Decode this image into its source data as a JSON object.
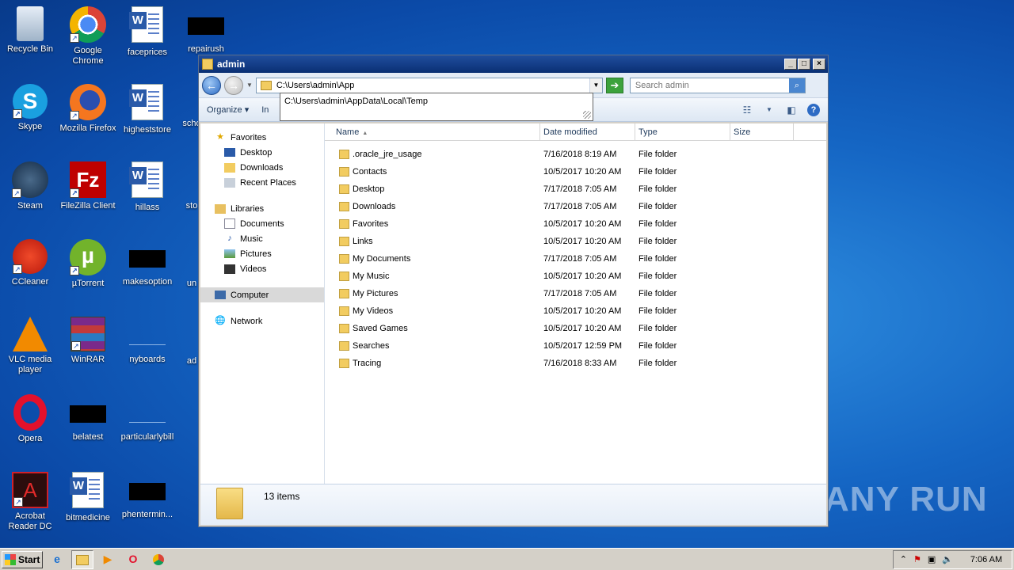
{
  "desktop": {
    "icons": [
      {
        "label": "Recycle Bin"
      },
      {
        "label": "Google Chrome"
      },
      {
        "label": "faceprices"
      },
      {
        "label": "repairush"
      },
      {
        "label": "Skype"
      },
      {
        "label": "Mozilla Firefox"
      },
      {
        "label": "higheststore"
      },
      {
        "label": "scho"
      },
      {
        "label": "Steam"
      },
      {
        "label": "FileZilla Client"
      },
      {
        "label": "hillass"
      },
      {
        "label": "sto"
      },
      {
        "label": "CCleaner"
      },
      {
        "label": "µTorrent"
      },
      {
        "label": "makesoption"
      },
      {
        "label": "un"
      },
      {
        "label": "VLC media player"
      },
      {
        "label": "WinRAR"
      },
      {
        "label": "nyboards"
      },
      {
        "label": "ad"
      },
      {
        "label": "Opera"
      },
      {
        "label": "belatest"
      },
      {
        "label": "particularlybill"
      },
      {
        "label": "Acrobat Reader DC"
      },
      {
        "label": "bitmedicine"
      },
      {
        "label": "phentermin..."
      }
    ]
  },
  "window": {
    "title": "admin",
    "address_value": "C:\\Users\\admin\\App",
    "search_placeholder": "Search admin",
    "suggestion": "C:\\Users\\admin\\AppData\\Local\\Temp",
    "toolbar": {
      "organize": "Organize",
      "include": "In"
    },
    "nav": {
      "favorites": "Favorites",
      "desktop": "Desktop",
      "downloads": "Downloads",
      "recent_places": "Recent Places",
      "libraries": "Libraries",
      "documents": "Documents",
      "music": "Music",
      "pictures": "Pictures",
      "videos": "Videos",
      "computer": "Computer",
      "network": "Network"
    },
    "columns": {
      "name": "Name",
      "date": "Date modified",
      "type": "Type",
      "size": "Size"
    },
    "files": [
      {
        "name": ".oracle_jre_usage",
        "date": "7/16/2018 8:19 AM",
        "type": "File folder"
      },
      {
        "name": "Contacts",
        "date": "10/5/2017 10:20 AM",
        "type": "File folder"
      },
      {
        "name": "Desktop",
        "date": "7/17/2018 7:05 AM",
        "type": "File folder"
      },
      {
        "name": "Downloads",
        "date": "7/17/2018 7:05 AM",
        "type": "File folder"
      },
      {
        "name": "Favorites",
        "date": "10/5/2017 10:20 AM",
        "type": "File folder"
      },
      {
        "name": "Links",
        "date": "10/5/2017 10:20 AM",
        "type": "File folder"
      },
      {
        "name": "My Documents",
        "date": "7/17/2018 7:05 AM",
        "type": "File folder"
      },
      {
        "name": "My Music",
        "date": "10/5/2017 10:20 AM",
        "type": "File folder"
      },
      {
        "name": "My Pictures",
        "date": "7/17/2018 7:05 AM",
        "type": "File folder"
      },
      {
        "name": "My Videos",
        "date": "10/5/2017 10:20 AM",
        "type": "File folder"
      },
      {
        "name": "Saved Games",
        "date": "10/5/2017 10:20 AM",
        "type": "File folder"
      },
      {
        "name": "Searches",
        "date": "10/5/2017 12:59 PM",
        "type": "File folder"
      },
      {
        "name": "Tracing",
        "date": "7/16/2018 8:33 AM",
        "type": "File folder"
      }
    ],
    "status": "13 items"
  },
  "taskbar": {
    "start": "Start",
    "clock": "7:06 AM"
  },
  "watermark": "ANY RUN"
}
